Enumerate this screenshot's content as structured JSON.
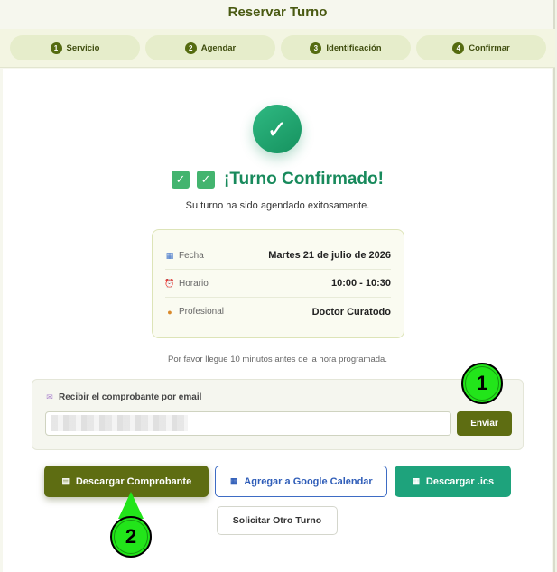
{
  "header": {
    "title": "Reservar Turno"
  },
  "steps": [
    {
      "num": "1",
      "label": "Servicio"
    },
    {
      "num": "2",
      "label": "Agendar"
    },
    {
      "num": "3",
      "label": "Identificación"
    },
    {
      "num": "4",
      "label": "Confirmar"
    }
  ],
  "confirmation": {
    "check_symbol": "✓",
    "title": "¡Turno Confirmado!",
    "subtitle": "Su turno ha sido agendado exitosamente."
  },
  "details": [
    {
      "icon": "calendar-icon",
      "label": "Fecha",
      "value": "Martes 21 de julio de 2026"
    },
    {
      "icon": "alarm-clock-icon",
      "label": "Horario",
      "value": "10:00 - 10:30"
    },
    {
      "icon": "person-icon",
      "label": "Profesional",
      "value": "Doctor Curatodo"
    }
  ],
  "note": "Por favor llegue 10 minutos antes de la hora programada.",
  "email": {
    "label": "Recibir el comprobante por email",
    "value": "",
    "send_label": "Enviar"
  },
  "actions": {
    "download_receipt": "Descargar Comprobante",
    "google_calendar": "Agregar a Google Calendar",
    "download_ics": "Descargar .ics",
    "another": "Solicitar Otro Turno"
  },
  "markers": {
    "one": "1",
    "two": "2"
  },
  "colors": {
    "primary": "#5e6d12",
    "success": "#188a5c",
    "google": "#2f5db8",
    "ics": "#1ea37c"
  }
}
